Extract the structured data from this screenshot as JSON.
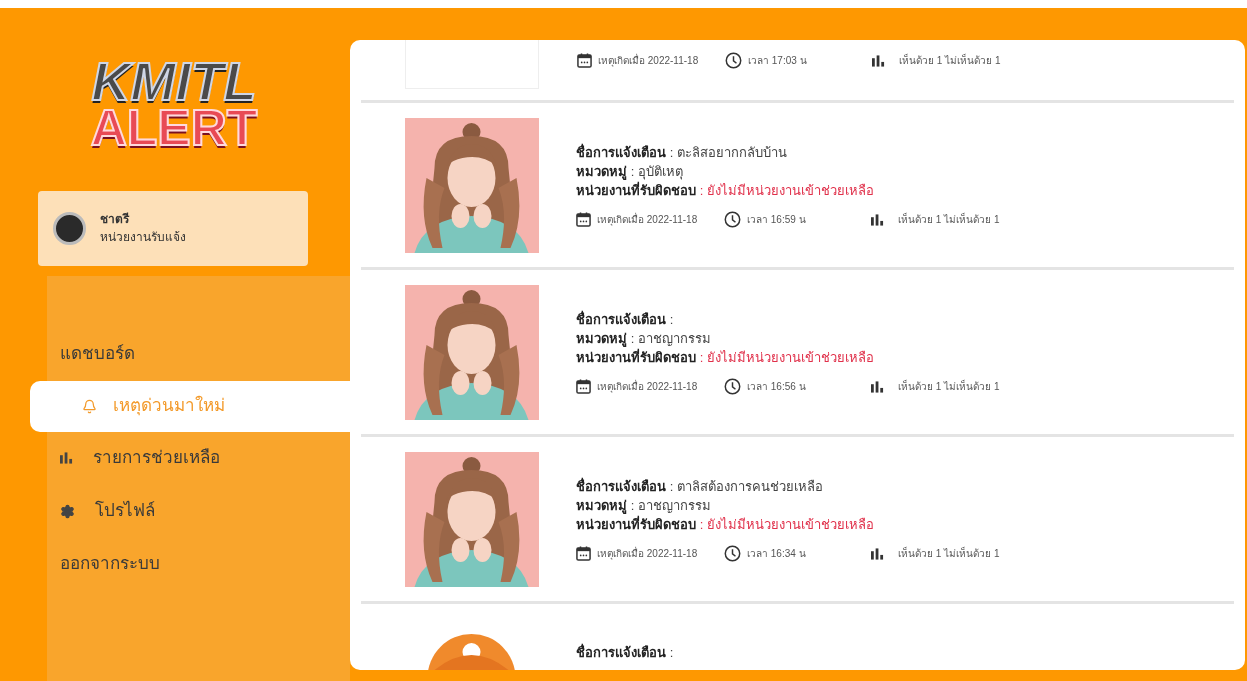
{
  "logo": {
    "line_1": "KMITL",
    "line_2": "ALERT"
  },
  "user": {
    "name": "ชาตรี",
    "role": "หน่วยงานรับแจ้ง"
  },
  "menu": [
    {
      "kind": "heading",
      "label": "แดชบอร์ด",
      "selected": false
    },
    {
      "kind": "bell",
      "label": "เหตุด่วนมาใหม่",
      "selected": true
    },
    {
      "kind": "chart",
      "label": "รายการช่วยเหลือ",
      "selected": false
    },
    {
      "kind": "gear",
      "label": "โปรไฟล์",
      "selected": false
    },
    {
      "kind": "heading",
      "label": "ออกจากระบบ",
      "selected": false
    }
  ],
  "alerts": [
    {
      "kind": "cut-top",
      "date": "เหตุเกิดเมื่อ 2022-11-18",
      "time": "เวลา 17:03 น",
      "votes": "เห็นด้วย 1 ไม่เห็นด้วย 1"
    },
    {
      "kind": "full",
      "lines": [
        {
          "label": "ชื่อการแจ้งเตือน",
          "value": ": ตะลิสอยากกลับบ้าน",
          "alert": false
        },
        {
          "label": "หมวดหมู่",
          "value": ": อุบัติเหตุ",
          "alert": false
        },
        {
          "label": "หน่วยงานที่รับผิดชอบ",
          "value": ": ยังไม่มีหน่วยงานเข้าช่วยเหลือ",
          "alert": true
        }
      ],
      "date": "เหตุเกิดเมื่อ 2022-11-18",
      "time": "เวลา 16:59 น",
      "votes": "เห็นด้วย 1 ไม่เห็นด้วย 1"
    },
    {
      "kind": "full",
      "lines": [
        {
          "label": "ชื่อการแจ้งเตือน",
          "value": ":",
          "alert": false
        },
        {
          "label": "หมวดหมู่",
          "value": ": อาชญากรรม",
          "alert": false
        },
        {
          "label": "หน่วยงานที่รับผิดชอบ",
          "value": ": ยังไม่มีหน่วยงานเข้าช่วยเหลือ",
          "alert": true
        }
      ],
      "date": "เหตุเกิดเมื่อ 2022-11-18",
      "time": "เวลา 16:56 น",
      "votes": "เห็นด้วย 1 ไม่เห็นด้วย 1"
    },
    {
      "kind": "full",
      "lines": [
        {
          "label": "ชื่อการแจ้งเตือน",
          "value": ": ตาลิสต้องการคนช่วยเหลือ",
          "alert": false
        },
        {
          "label": "หมวดหมู่",
          "value": ": อาชญากรรม",
          "alert": false
        },
        {
          "label": "หน่วยงานที่รับผิดชอบ",
          "value": ": ยังไม่มีหน่วยงานเข้าช่วยเหลือ",
          "alert": true
        }
      ],
      "date": "เหตุเกิดเมื่อ 2022-11-18",
      "time": "เวลา 16:34 น",
      "votes": "เห็นด้วย 1 ไม่เห็นด้วย 1"
    },
    {
      "kind": "cut-bottom",
      "lines": [
        {
          "label": "ชื่อการแจ้งเตือน",
          "value": ":",
          "alert": false
        }
      ]
    }
  ]
}
